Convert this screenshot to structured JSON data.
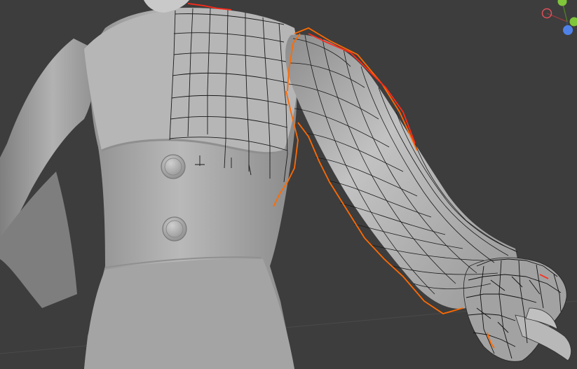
{
  "viewport": {
    "background_color": "#3d3d3d",
    "grid_line_color": "#4a4a4a",
    "mesh_base_color": "#a9a9a9",
    "mesh_highlight_color": "#c4c4c4",
    "mesh_shadow_color": "#7c7c7c",
    "wire_color": "#1a1a1a",
    "selection_outline_color": "#ff6a00",
    "active_edge_color": "#ff2a1a"
  },
  "gizmo": {
    "x_axis_color": "#e0505a",
    "y_axis_color": "#7fc63a",
    "z_axis_color": "#4f82e8",
    "x_axis_icon": "x-axis-circle-icon",
    "y_axis_icon": "y-axis-circle-icon",
    "z_axis_icon": "z-axis-circle-icon"
  }
}
